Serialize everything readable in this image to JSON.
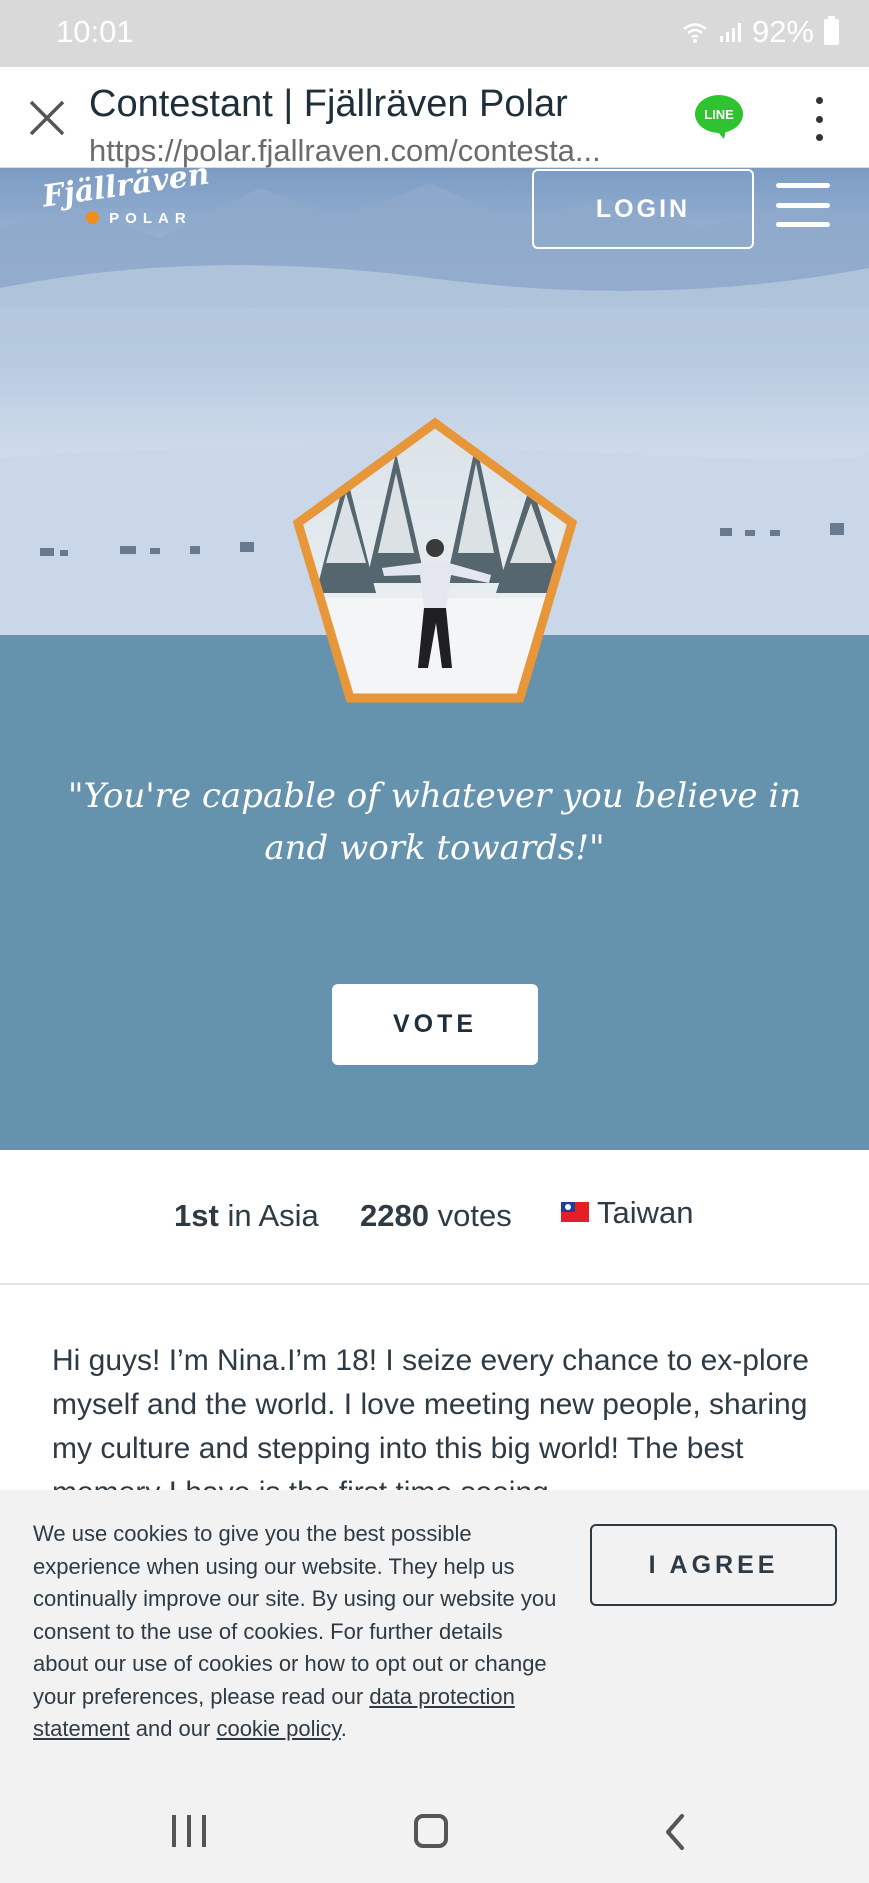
{
  "status_bar": {
    "time": "10:01",
    "battery": "92%"
  },
  "browser": {
    "title": "Contestant | Fjällräven Polar",
    "url": "https://polar.fjallraven.com/contesta...",
    "line_label": "LINE"
  },
  "header": {
    "logo_script": "Fjällräven",
    "logo_polar": "POLAR",
    "login_label": "LOGIN"
  },
  "contestant": {
    "quote": "\"You're capable of whatever you believe in and work towards!\"",
    "vote_label": "VOTE"
  },
  "stats": {
    "rank": "1st",
    "rank_suffix": "in Asia",
    "votes_count": "2280",
    "votes_suffix": "votes",
    "country": "Taiwan"
  },
  "bio": {
    "text": "Hi guys! I’m Nina.I’m 18! I seize every chance to ex-plore myself and the world. I love meeting new people, sharing my culture and stepping into this big world! The best memory I have is the first time seeing"
  },
  "cookie": {
    "text_intro": "We use cookies to give you the best possible experience when using our website. They help us continually improve our site. By using our website you consent to the use of cookies. For further details about our use of cookies or how to opt out or change your preferences, please read our ",
    "link_data": "data protection statement",
    "text_mid": " and our ",
    "link_cookie": "cookie policy",
    "text_end": ".",
    "agree_label": "I AGREE"
  },
  "colors": {
    "accent_blue": "#6592ad",
    "pentagon_border": "#e8963a",
    "line_green": "#2fc32f",
    "name_highlight": "#b3e61f"
  }
}
